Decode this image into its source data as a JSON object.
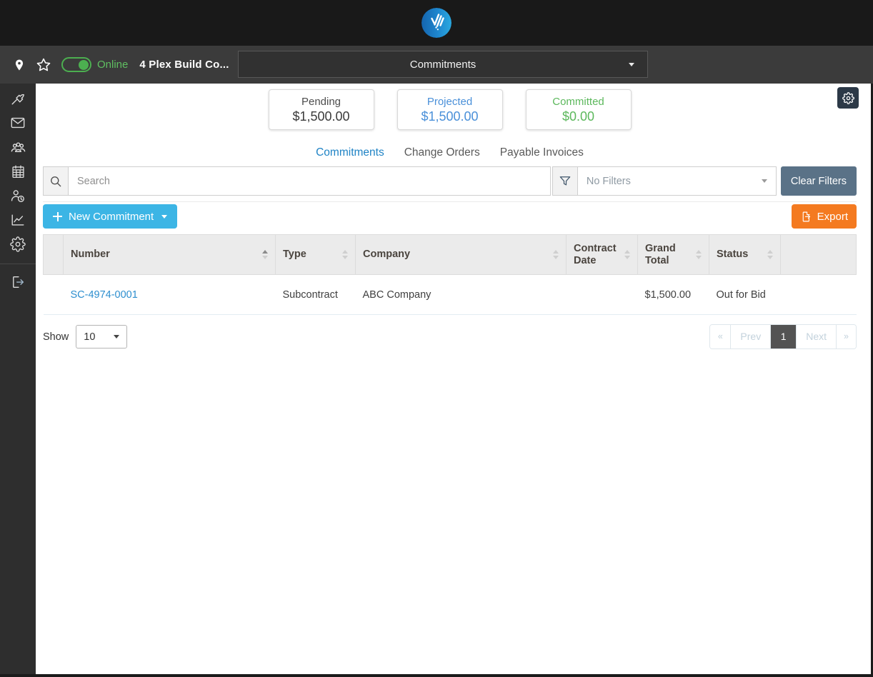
{
  "subheader": {
    "online_label": "Online",
    "project_name": "4 Plex Build Co...",
    "page_selector_label": "Commitments"
  },
  "summary_cards": [
    {
      "label": "Pending",
      "value": "$1,500.00"
    },
    {
      "label": "Projected",
      "value": "$1,500.00"
    },
    {
      "label": "Committed",
      "value": "$0.00"
    }
  ],
  "tabs": [
    {
      "label": "Commitments",
      "active": true
    },
    {
      "label": "Change Orders",
      "active": false
    },
    {
      "label": "Payable Invoices",
      "active": false
    }
  ],
  "toolbar": {
    "search_placeholder": "Search",
    "filter_placeholder": "No Filters",
    "clear_filters_label": "Clear Filters",
    "new_commitment_label": "New Commitment",
    "export_label": "Export"
  },
  "table": {
    "columns": [
      {
        "label": "Number"
      },
      {
        "label": "Type"
      },
      {
        "label": "Company"
      },
      {
        "label": "Contract Date"
      },
      {
        "label": "Grand Total"
      },
      {
        "label": "Status"
      }
    ],
    "rows": [
      {
        "number": "SC-4974-0001",
        "type": "Subcontract",
        "company": "ABC Company",
        "contract_date": "",
        "grand_total": "$1,500.00",
        "status": "Out for Bid"
      }
    ]
  },
  "pagination": {
    "show_label": "Show",
    "page_size": "10",
    "first_label": "«",
    "prev_label": "Prev",
    "current_page": "1",
    "next_label": "Next",
    "last_label": "»"
  },
  "sidebar_icons": [
    "hammer",
    "envelope",
    "team",
    "calendar",
    "time-clock",
    "line-chart",
    "gear",
    "logout"
  ],
  "colors": {
    "accent_blue": "#1f83c5",
    "link_blue": "#2e8fcf",
    "button_blue": "#3cb5e5",
    "button_orange": "#f47a20",
    "clear_filters_slate": "#5a7287",
    "online_green": "#5fbf61",
    "projected_blue": "#4a90d9",
    "committed_green": "#5cb85c",
    "pagination_active": "#535353"
  }
}
